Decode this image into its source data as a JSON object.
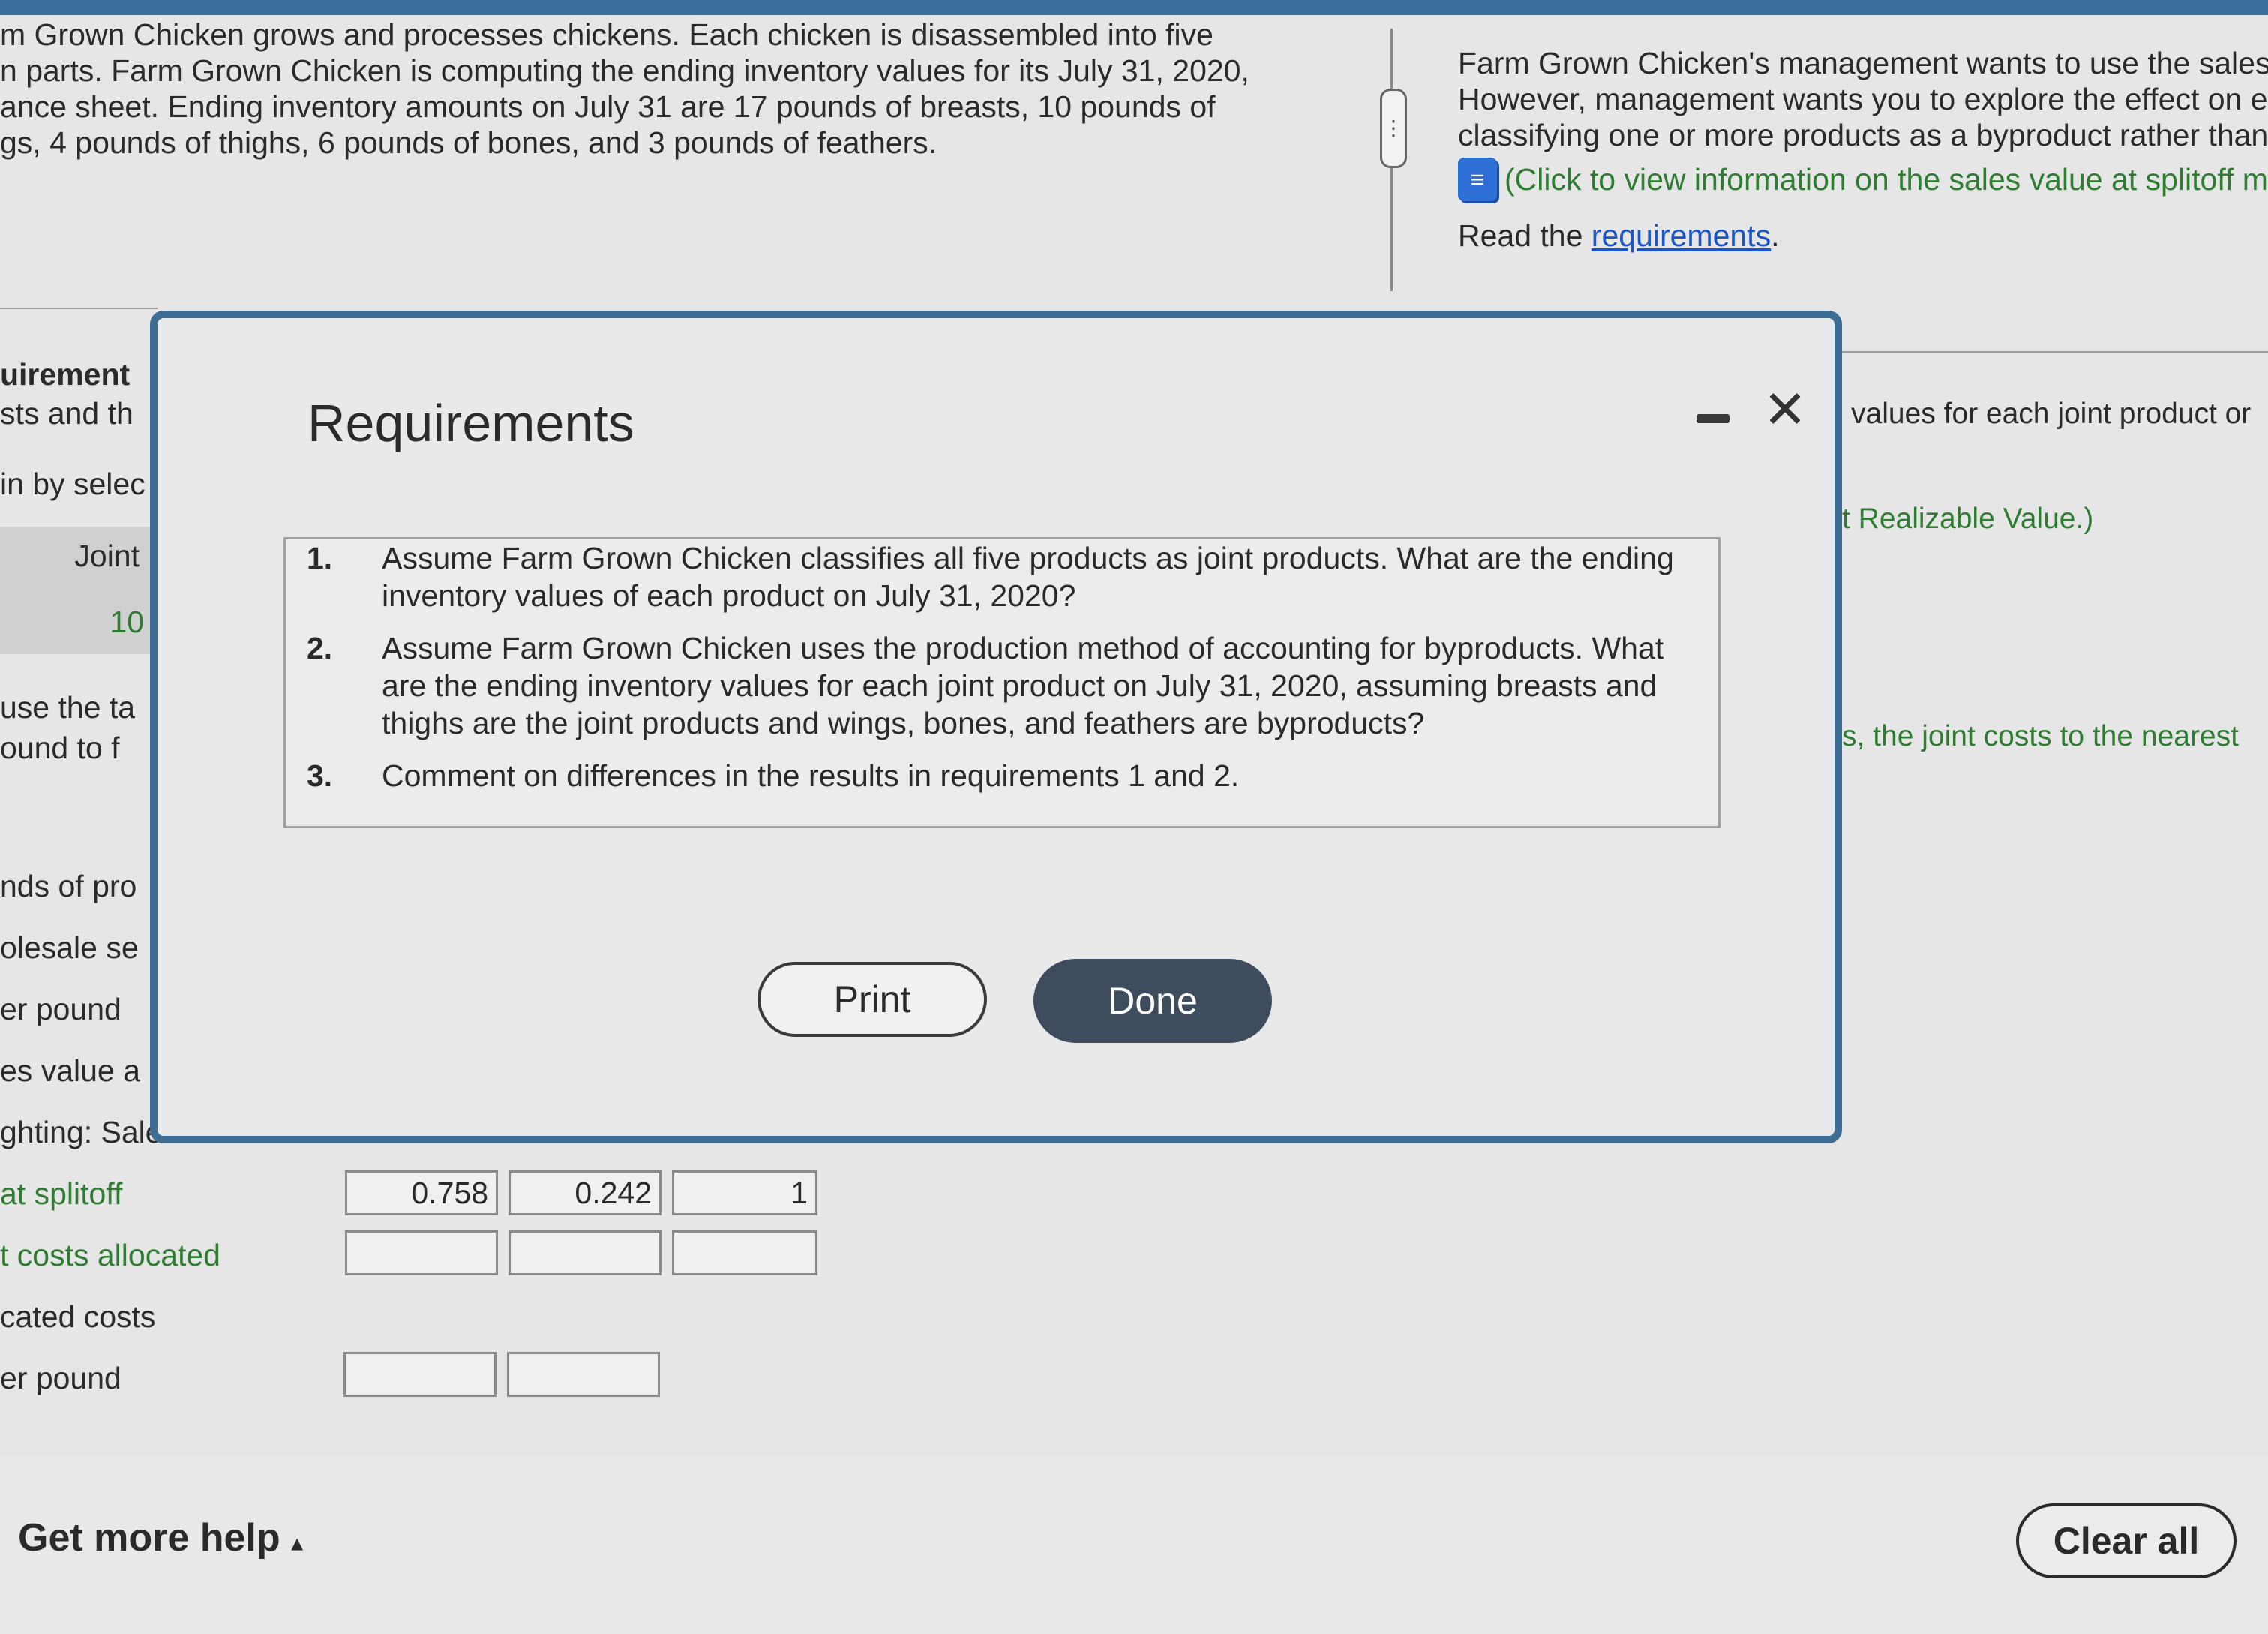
{
  "problem": {
    "lines": [
      "m Grown Chicken grows and processes chickens. Each chicken is disassembled into five",
      "n parts. Farm Grown Chicken is computing the ending inventory values for its July 31, 2020,",
      "ance sheet. Ending inventory amounts on July 31 are 17 pounds of breasts, 10 pounds of",
      "gs, 4 pounds of thighs, 6 pounds of bones, and 3 pounds of feathers."
    ]
  },
  "right_panel": {
    "lines": [
      "Farm Grown Chicken's management wants to use the sales",
      "However, management wants you to explore the effect on er",
      "classifying one or more products as a byproduct rather than"
    ],
    "data_link": "(Click to view information on the sales value at splitoff m",
    "read_prefix": "Read the ",
    "read_link": "requirements",
    "read_suffix": ".",
    "partial_1": "values for each joint product or",
    "partial_2": "t Realizable Value.)",
    "partial_3": "s, the joint costs to the nearest"
  },
  "left_strip": {
    "requirement": "uirement",
    "costs": "sts and th",
    "select": "in by selec",
    "joint": "Joint",
    "ten": "10",
    "use": "use the ta",
    "pound": "ound to f",
    "pounds_of": "nds of pro",
    "wholesale": "olesale se",
    "per_pound": "er pound",
    "sales_value": "es value a",
    "weighting": "ghting: Sales value"
  },
  "bottom_rows": {
    "splitoff": "at splitoff",
    "costs_allocated": "t costs allocated",
    "allocated_costs": "cated costs",
    "per_pound": "er pound"
  },
  "cells": {
    "w1": "0.758",
    "w2": "0.242",
    "w3": "1"
  },
  "modal": {
    "title": "Requirements",
    "items": [
      {
        "num": "1.",
        "text": "Assume Farm Grown Chicken classifies all five products as joint products. What are the ending inventory values of each product on July 31, 2020?"
      },
      {
        "num": "2.",
        "text": "Assume Farm Grown Chicken uses the production method of accounting for byproducts. What are the ending inventory values for each joint product on July 31, 2020, assuming breasts and thighs are the joint products and wings, bones, and feathers are byproducts?"
      },
      {
        "num": "3.",
        "text": "Comment on differences in the results in requirements 1 and 2."
      }
    ],
    "print_label": "Print",
    "done_label": "Done"
  },
  "footer": {
    "help_label": "Get more help",
    "help_arrow": "▴",
    "clear_label": "Clear all"
  },
  "icons": {
    "minimize": "minimize-icon",
    "close": "close-icon",
    "document": "document-icon"
  }
}
